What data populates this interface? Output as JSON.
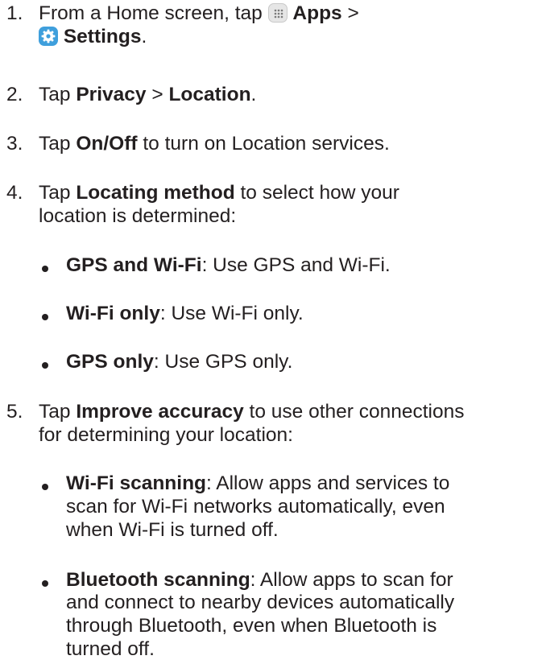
{
  "steps": [
    {
      "number": "1.",
      "parts": [
        "From a Home screen, tap",
        "Apps",
        ">",
        "Settings",
        "."
      ]
    },
    {
      "number": "2.",
      "parts": [
        "Tap",
        "Privacy",
        ">",
        "Location",
        "."
      ]
    },
    {
      "number": "3.",
      "parts": [
        "Tap",
        "On/Off",
        "to turn on Location services."
      ]
    },
    {
      "number": "4.",
      "parts": [
        "Tap",
        "Locating method",
        "to select how your",
        "location is determined:"
      ],
      "bullets": [
        {
          "term": "GPS and Wi-Fi",
          "text": ": Use GPS and Wi-Fi."
        },
        {
          "term": "Wi-Fi only",
          "text": ": Use Wi-Fi only."
        },
        {
          "term": "GPS only",
          "text": ": Use GPS only."
        }
      ]
    },
    {
      "number": "5.",
      "parts": [
        "Tap",
        "Improve accuracy",
        "to use other connections",
        "for determining your location:"
      ],
      "bullets": [
        {
          "term": "Wi-Fi scanning",
          "lines": [
            ": Allow apps and services to",
            "scan for Wi-Fi networks automatically, even",
            "when Wi-Fi is turned off."
          ]
        },
        {
          "term": "Bluetooth scanning",
          "lines": [
            ": Allow apps to scan for",
            "and connect to nearby devices automatically",
            "through Bluetooth, even when Bluetooth is",
            "turned off."
          ]
        }
      ]
    }
  ],
  "icons": {
    "apps": "apps-grid-icon",
    "settings": "settings-gear-icon"
  },
  "colors": {
    "text": "#231f20",
    "settings_icon_bg": "#3f9fdc"
  }
}
